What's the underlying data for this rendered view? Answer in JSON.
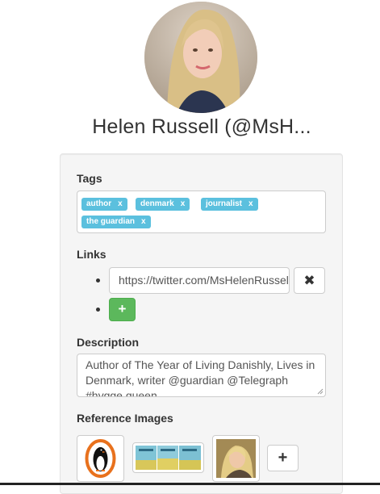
{
  "profile": {
    "name": "Helen Russell (@MsH...",
    "avatar_icon": "portrait-photo"
  },
  "tags_section": {
    "label": "Tags",
    "remove_symbol": "x",
    "accent_color": "#5bc0de",
    "tags": [
      "author",
      "denmark",
      "journalist",
      "the guardian"
    ]
  },
  "links_section": {
    "label": "Links",
    "links": [
      "https://twitter.com/MsHelenRussell"
    ],
    "remove_icon": "times-icon",
    "add_icon": "plus-icon",
    "add_button_color": "#5cb85c"
  },
  "description_section": {
    "label": "Description",
    "text": "Author of The Year of Living Danishly, Lives in Denmark, writer @guardian @Telegraph #hygge queen"
  },
  "reference_images_section": {
    "label": "Reference Images",
    "images": [
      {
        "icon": "penguin-logo"
      },
      {
        "icon": "book-covers-strip"
      },
      {
        "icon": "portrait-thumbnail"
      }
    ],
    "add_icon": "plus-icon"
  }
}
